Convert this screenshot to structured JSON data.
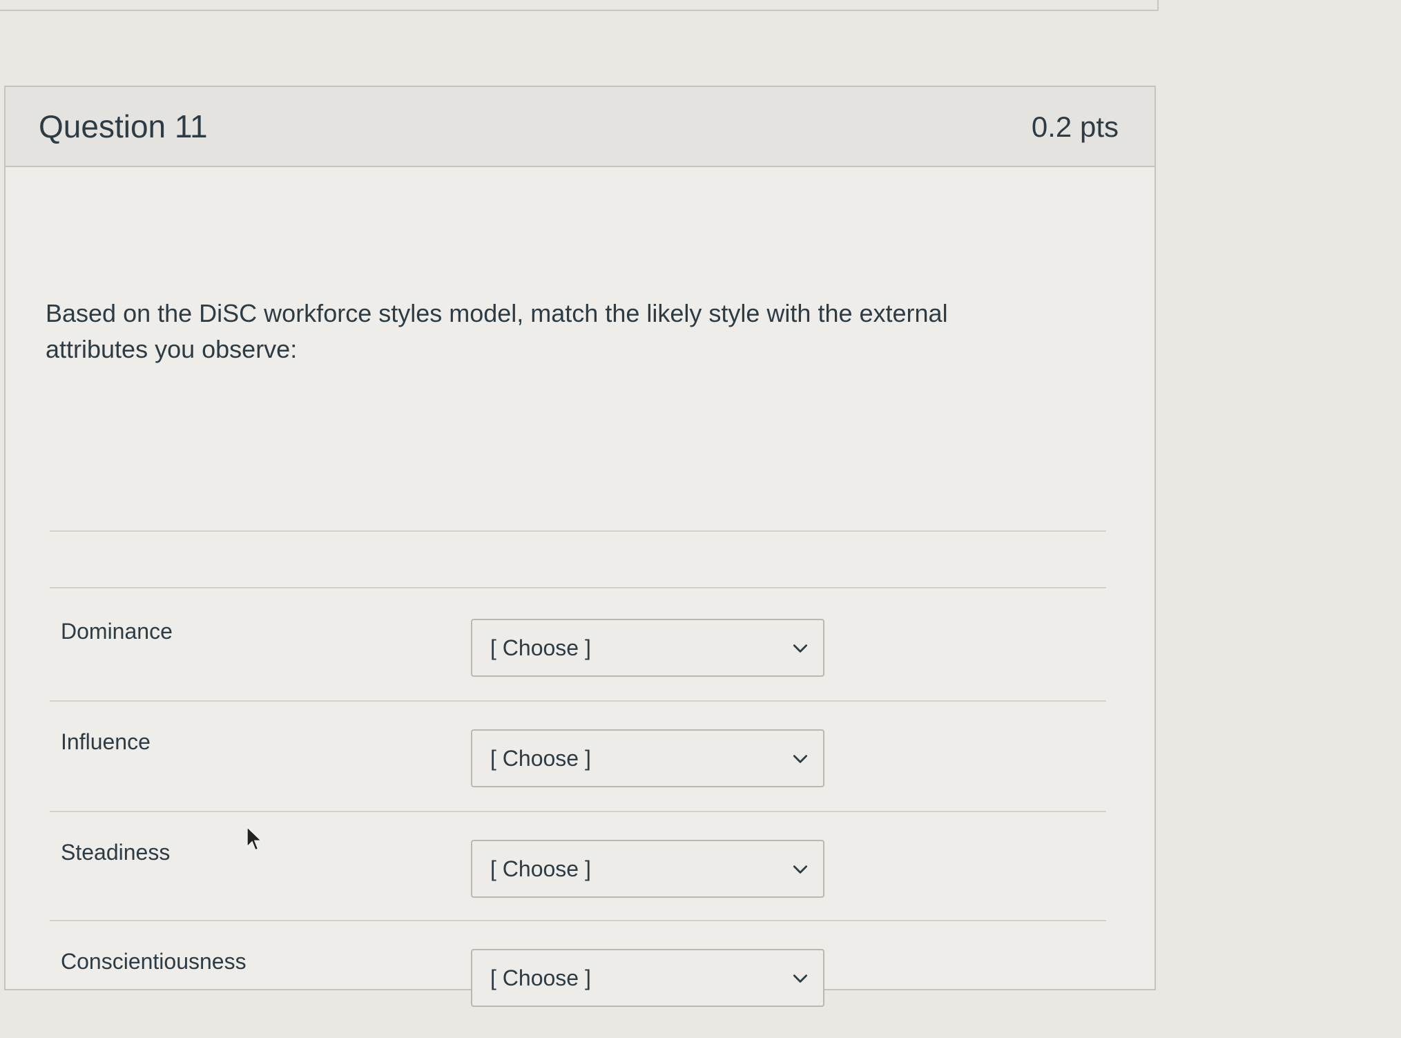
{
  "question": {
    "title": "Question 11",
    "points": "0.2 pts",
    "text": "Based on the DiSC workforce styles model, match the likely style with the external attributes you observe:"
  },
  "matches": [
    {
      "label": "Dominance",
      "selected": "[ Choose ]"
    },
    {
      "label": "Influence",
      "selected": "[ Choose ]"
    },
    {
      "label": "Steadiness",
      "selected": "[ Choose ]"
    },
    {
      "label": "Conscientiousness",
      "selected": "[ Choose ]"
    }
  ],
  "icons": {
    "dropdown": "chevron-down-icon",
    "pointer": "mouse-cursor-icon"
  }
}
